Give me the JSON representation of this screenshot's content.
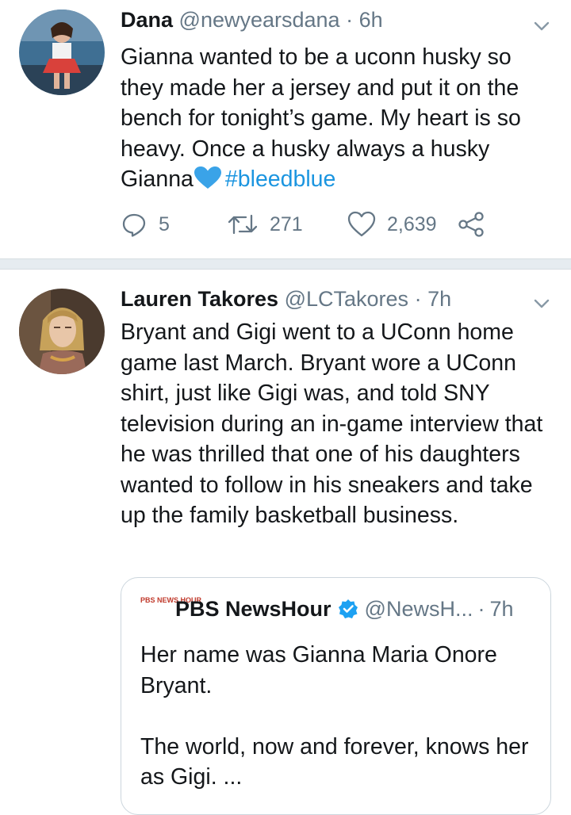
{
  "tweets": [
    {
      "author": "Dana",
      "handle": "@newyearsdana",
      "dot": "·",
      "time": "6h",
      "text": "Gianna wanted to be a uconn husky so they made her a jersey and put it on the bench for tonight’s game. My heart is so heavy. Once a husky always a husky Gianna",
      "emoji": "blue-heart",
      "hashtag": "#bleedblue",
      "actions": {
        "replies": "5",
        "retweets": "271",
        "likes": "2,639"
      }
    },
    {
      "author": "Lauren Takores",
      "handle": "@LCTakores",
      "dot": "·",
      "time": "7h",
      "text": "Bryant and Gigi went to a UConn home game last March. Bryant wore a UConn shirt, just like Gigi was, and told SNY television during an in-game interview that he was thrilled that one of his daughters wanted to follow in his sneakers and take up the family basketball business.",
      "quote": {
        "logo_text": "PBS NEWS HOUR",
        "author": "PBS NewsHour",
        "handle": "@NewsH...",
        "dot": "·",
        "time": "7h",
        "text": "Her name was Gianna Maria Onore Bryant.\n\nThe world, now and forever, knows her as Gigi. ..."
      }
    }
  ],
  "colors": {
    "link": "#1b95e0",
    "muted": "#657786",
    "separator": "#e6ecf0",
    "heart_emoji": "#3aa3e8"
  },
  "icons": [
    "reply-icon",
    "retweet-icon",
    "like-icon",
    "share-icon",
    "chevron-down-icon",
    "verified-icon"
  ]
}
